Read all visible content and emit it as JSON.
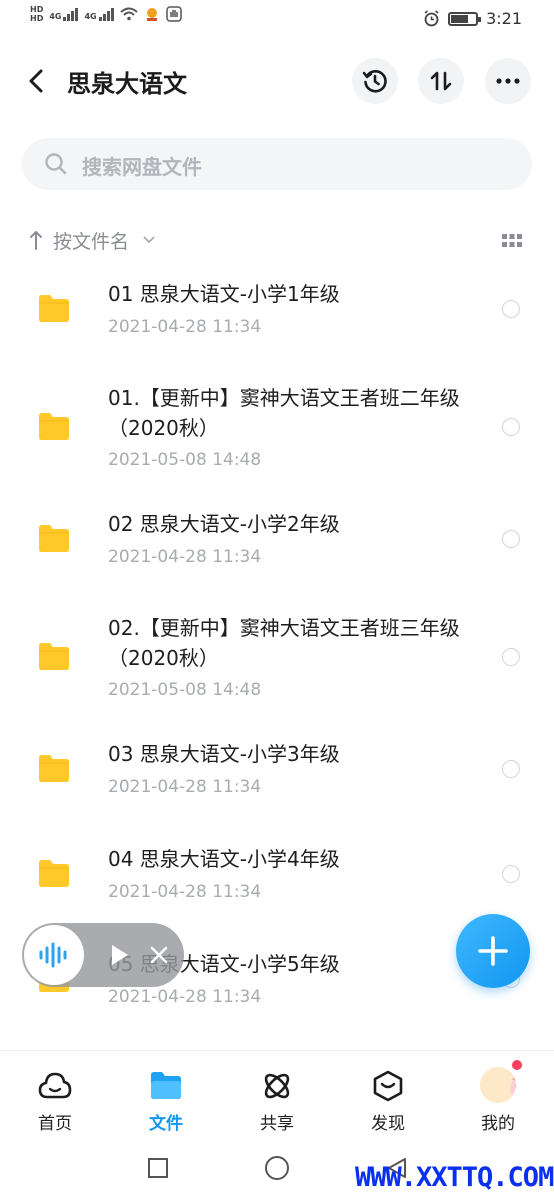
{
  "status_bar": {
    "hd1": "HD",
    "hd2": "HD",
    "net1": "4G",
    "net2": "4G",
    "time": "3:21"
  },
  "header": {
    "title": "思泉大语文"
  },
  "search": {
    "placeholder": "搜索网盘文件"
  },
  "sort": {
    "label": "按文件名"
  },
  "files": [
    {
      "name": "01 思泉大语文-小学1年级",
      "date": "2021-04-28  11:34"
    },
    {
      "name": "01.【更新中】窦神大语文王者班二年级（2020秋）",
      "date": "2021-05-08  14:48"
    },
    {
      "name": "02 思泉大语文-小学2年级",
      "date": "2021-04-28  11:34"
    },
    {
      "name": "02.【更新中】窦神大语文王者班三年级（2020秋）",
      "date": "2021-05-08  14:48"
    },
    {
      "name": "03 思泉大语文-小学3年级",
      "date": "2021-04-28  11:34"
    },
    {
      "name": "04 思泉大语文-小学4年级",
      "date": "2021-04-28  11:34"
    },
    {
      "name": "05 思泉大语文-小学5年级",
      "date": "2021-04-28  11:34"
    }
  ],
  "nav": {
    "home": "首页",
    "files": "文件",
    "share": "共享",
    "discover": "发现",
    "mine": "我的"
  },
  "watermark": "WWW.XXTTQ.COM",
  "colors": {
    "accent": "#1296f0",
    "folder": "#ffc929",
    "badge": "#f4405a"
  },
  "icons": [
    "back-arrow-icon",
    "history-icon",
    "sort-icon",
    "more-icon",
    "search-icon",
    "grid-view-icon",
    "folder-icon",
    "audio-wave-icon",
    "play-icon",
    "close-icon",
    "plus-icon",
    "home-cloud-icon",
    "files-icon",
    "share-atom-icon",
    "discover-compass-icon"
  ]
}
